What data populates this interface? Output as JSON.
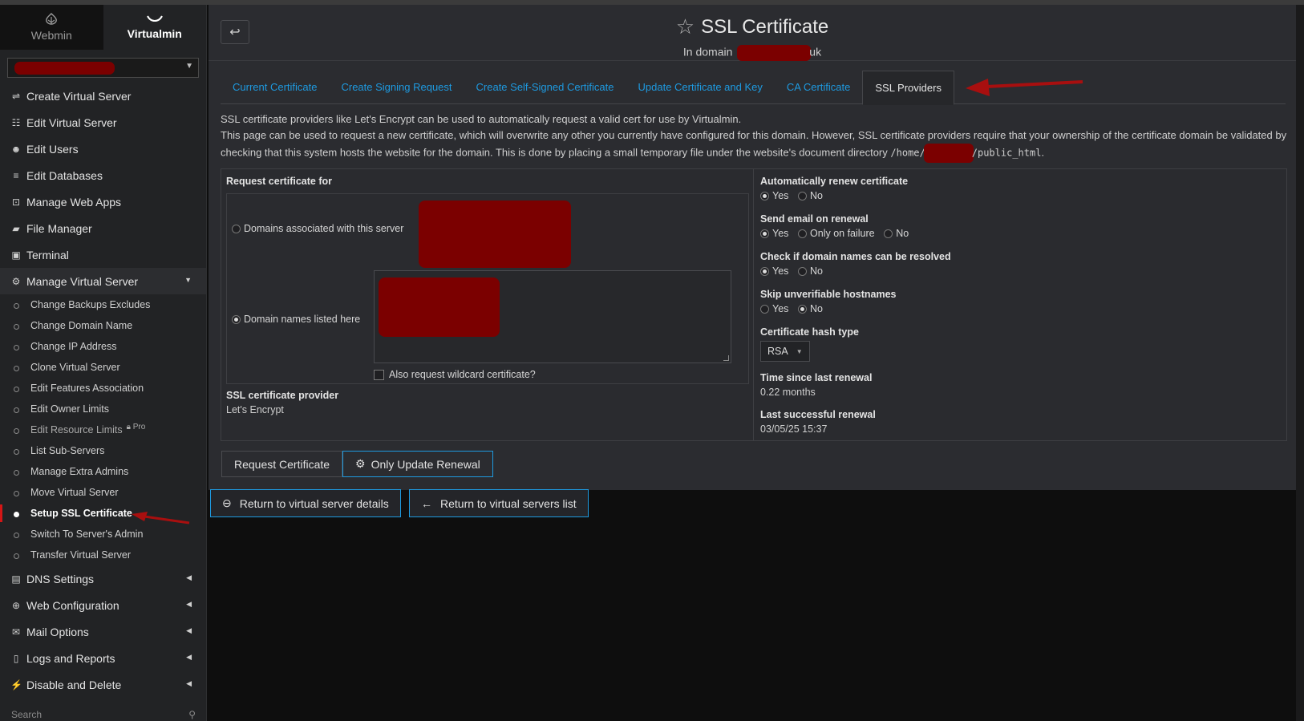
{
  "switcher": {
    "webmin": "Webmin",
    "virtualmin": "Virtualmin"
  },
  "sidebar": {
    "items": [
      {
        "label": "Create Virtual Server",
        "icon": "signpost-icon"
      },
      {
        "label": "Edit Virtual Server",
        "icon": "sliders-icon"
      },
      {
        "label": "Edit Users",
        "icon": "users-icon"
      },
      {
        "label": "Edit Databases",
        "icon": "database-icon"
      },
      {
        "label": "Manage Web Apps",
        "icon": "download-box-icon"
      },
      {
        "label": "File Manager",
        "icon": "folder-icon"
      },
      {
        "label": "Terminal",
        "icon": "terminal-icon"
      }
    ],
    "manage_vs": {
      "label": "Manage Virtual Server"
    },
    "subitems": [
      "Change Backups Excludes",
      "Change Domain Name",
      "Change IP Address",
      "Clone Virtual Server",
      "Edit Features Association",
      "Edit Owner Limits",
      "Edit Resource Limits",
      "List Sub-Servers",
      "Manage Extra Admins",
      "Move Virtual Server",
      "Setup SSL Certificate",
      "Switch To Server's Admin",
      "Transfer Virtual Server"
    ],
    "pro_badge": "Pro",
    "bottom": [
      {
        "label": "DNS Settings",
        "icon": "server-icon"
      },
      {
        "label": "Web Configuration",
        "icon": "globe-icon"
      },
      {
        "label": "Mail Options",
        "icon": "mail-open-icon"
      },
      {
        "label": "Logs and Reports",
        "icon": "file-report-icon"
      },
      {
        "label": "Disable and Delete",
        "icon": "plug-icon"
      }
    ],
    "search_placeholder": "Search"
  },
  "page": {
    "title": "SSL Certificate",
    "subtitle_prefix": "In domain",
    "subtitle_suffix": "uk"
  },
  "tabs": [
    "Current Certificate",
    "Create Signing Request",
    "Create Self-Signed Certificate",
    "Update Certificate and Key",
    "CA Certificate",
    "SSL Providers"
  ],
  "active_tab": "SSL Providers",
  "description": {
    "line1": "SSL certificate providers like Let's Encrypt can be used to automatically request a valid cert for use by Virtualmin.",
    "line2": "This page can be used to request a new certificate, which will overwrite any other you currently have configured for this domain. However, SSL certificate providers require that your ownership of the certificate domain be validated by checking that this system hosts the website for the domain. This is done by placing a small temporary file under the website's document directory",
    "path_prefix": "/home/",
    "path_suffix": "/public_html",
    "end": "."
  },
  "form": {
    "request_for_label": "Request certificate for",
    "option_associated": "Domains associated with this server",
    "option_listed": "Domain names listed here",
    "wildcard_label": "Also request wildcard certificate?",
    "provider_label": "SSL certificate provider",
    "provider_value": "Let's Encrypt",
    "auto_renew_label": "Automatically renew certificate",
    "send_email_label": "Send email on renewal",
    "check_resolve_label": "Check if domain names can be resolved",
    "skip_unverifiable_label": "Skip unverifiable hostnames",
    "hash_type_label": "Certificate hash type",
    "hash_type_value": "RSA",
    "time_since_label": "Time since last renewal",
    "time_since_value": "0.22 months",
    "last_success_label": "Last successful renewal",
    "last_success_value": "03/05/25 15:37",
    "yes": "Yes",
    "no": "No",
    "only_on_failure": "Only on failure"
  },
  "buttons": {
    "request": "Request Certificate",
    "only_update": "Only Update Renewal",
    "return_details": "Return to virtual server details",
    "return_list": "Return to virtual servers list"
  },
  "colors": {
    "accent": "#1e9ae0",
    "redaction": "#7b0000",
    "annotation_arrow": "#a80f0f"
  }
}
